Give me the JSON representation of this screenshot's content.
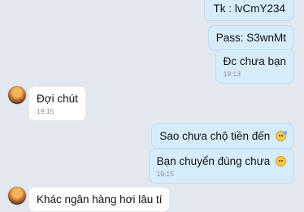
{
  "messages": [
    {
      "direction": "outgoing",
      "text": "Tk : lvCmY234",
      "time": ""
    },
    {
      "direction": "outgoing",
      "text": "Pass: S3wnMt",
      "time": ""
    },
    {
      "direction": "outgoing",
      "text": "Đc chưa bạn",
      "time": "19:13"
    },
    {
      "direction": "incoming",
      "text": "Đợi chút",
      "time": "19:15"
    },
    {
      "direction": "outgoing",
      "text": "Sao chưa chộ tiền đến",
      "time": "",
      "emoji": "grimacing-sweat-emoji"
    },
    {
      "direction": "outgoing",
      "text": "Bạn chuyển đúng chưa",
      "time": "19:15",
      "emoji": "worried-emoji"
    },
    {
      "direction": "incoming",
      "text": "Khác ngân hàng hơi lâu tí",
      "time": ""
    }
  ],
  "colors": {
    "background": "#e3e8ee",
    "outgoing": "#d6ecfb",
    "incoming": "#ffffff"
  }
}
